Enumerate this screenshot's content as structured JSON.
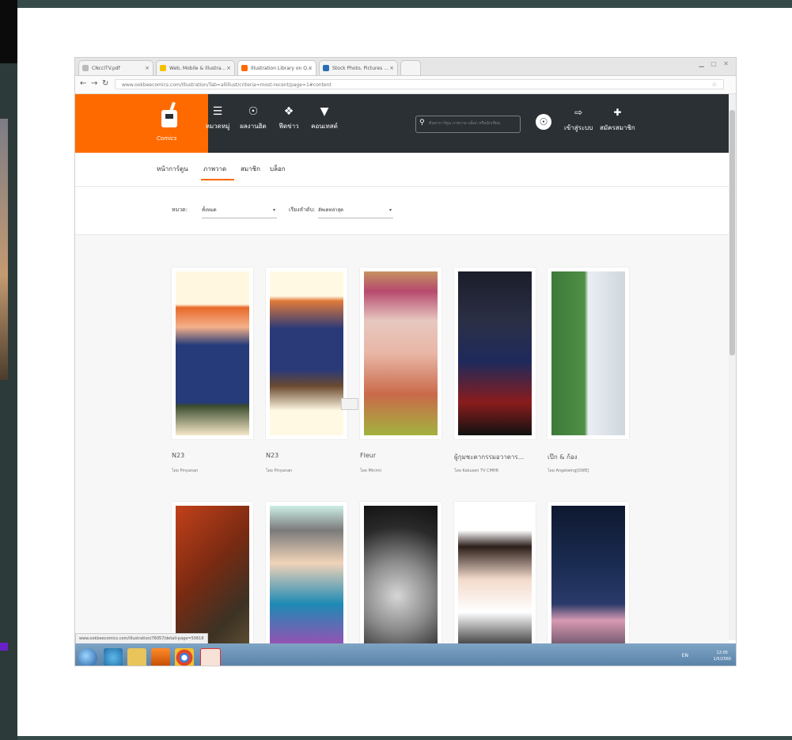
{
  "browser": {
    "tabs": [
      {
        "label": "CNccITV.pdf"
      },
      {
        "label": "Web, Mobile & illustra..."
      },
      {
        "label": "Illustration Library on O..."
      },
      {
        "label": "Stock Photo, Pictures ..."
      }
    ],
    "url": "www.ookbeecomics.com/Illustration/Tab=allillust/criteria=most-recent/page=1#content"
  },
  "header": {
    "logo_text": "Comics",
    "nav": [
      {
        "icon": "menu-icon",
        "label": "หมวดหมู่"
      },
      {
        "icon": "ranking-icon",
        "label": "ผลงานฮิต"
      },
      {
        "icon": "explore-icon",
        "label": "ฟีดข่าว"
      },
      {
        "icon": "trophy-icon",
        "label": "คอนเทสต์"
      }
    ],
    "search_placeholder": "ค้นหาการ์ตูน ภาพวาด บล็อก หรือนักเขียน",
    "login_label": "เข้าสู่ระบบ",
    "register_label": "สมัครสมาชิก"
  },
  "subnav": {
    "items": [
      "หน้าการ์ตูน",
      "ภาพวาด",
      "สมาชิก",
      "บล็อก"
    ],
    "active_index": 1
  },
  "filters": {
    "category_label": "หมวด:",
    "category_value": "ทั้งหมด",
    "sort_label": "เรียงลำดับ:",
    "sort_value": "อัพเดทล่าสุด"
  },
  "cards": [
    {
      "title": "N23",
      "author": "โดย Pinyanan"
    },
    {
      "title": "N23",
      "author": "โดย Pinyanan"
    },
    {
      "title": "Fleur",
      "author": "โดย Minimi"
    },
    {
      "title": "ผู้กุมชะตากรรมอวาตาร...",
      "author": "โดย Kakusen TV CMHR"
    },
    {
      "title": "เป๊ก & ก้อง",
      "author": "โดย Angelwing[OWE]"
    },
    {
      "title": "",
      "author": ""
    },
    {
      "title": "",
      "author": ""
    },
    {
      "title": "",
      "author": ""
    },
    {
      "title": "",
      "author": ""
    },
    {
      "title": "",
      "author": ""
    }
  ],
  "status_url": "www.ookbeecomics.com/Illustration/76057/detail-page=50618",
  "taskbar": {
    "tray_text": "EN",
    "time": "12:05",
    "date": "1/5/2560"
  },
  "colors": {
    "brand_orange": "#ff6a00",
    "header_dark": "#2b3034"
  }
}
